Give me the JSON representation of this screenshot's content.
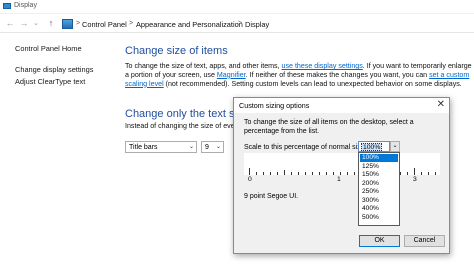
{
  "window": {
    "title": "Display"
  },
  "addressbar": {
    "back_arrow": "←",
    "forward_arrow": "→",
    "dropdown_arrow": "⌄",
    "up_arrow": "↑",
    "crumb_sep": ">",
    "crumbs": [
      "Control Panel",
      "Appearance and Personalization",
      "Display"
    ]
  },
  "sidebar": {
    "home": "Control Panel Home",
    "links": [
      "Change display settings",
      "Adjust ClearType text"
    ]
  },
  "main": {
    "size_heading": "Change size of items",
    "para1_a": "To change the size of text, apps, and other items, ",
    "para1_link": "use these display settings",
    "para1_b": ".  If you want to temporarily enlarge",
    "para2_a": "a portion of your screen, use ",
    "para2_link": "Magnifier",
    "para2_b": ".  If neither of these makes the changes you want, you can ",
    "para2_link2": "set a custom",
    "para3_link": "scaling level",
    "para3_b": " (not recommended).  Setting custom levels can lead to unexpected behavior on some displays.",
    "text_heading": "Change only the text size",
    "text_desc": "Instead of changing the size of ever",
    "item_select": "Title bars",
    "size_select": "9",
    "combo_arrow": "⌄"
  },
  "dialog": {
    "title": "Custom sizing options",
    "close": "✕",
    "desc_line1": "To change the size of all items on the desktop, select a",
    "desc_line2": "percentage from the list.",
    "scale_label": "Scale to this percentage of normal size:",
    "scale_value": "100%",
    "drop_arrow": "⌄",
    "ruler_labels": [
      "0",
      "1",
      "3"
    ],
    "sample": "9 point Segoe UI.",
    "options": [
      "100%",
      "125%",
      "150%",
      "200%",
      "250%",
      "300%",
      "400%",
      "500%"
    ],
    "selected_option": "100%",
    "ok": "OK",
    "cancel": "Cancel"
  }
}
